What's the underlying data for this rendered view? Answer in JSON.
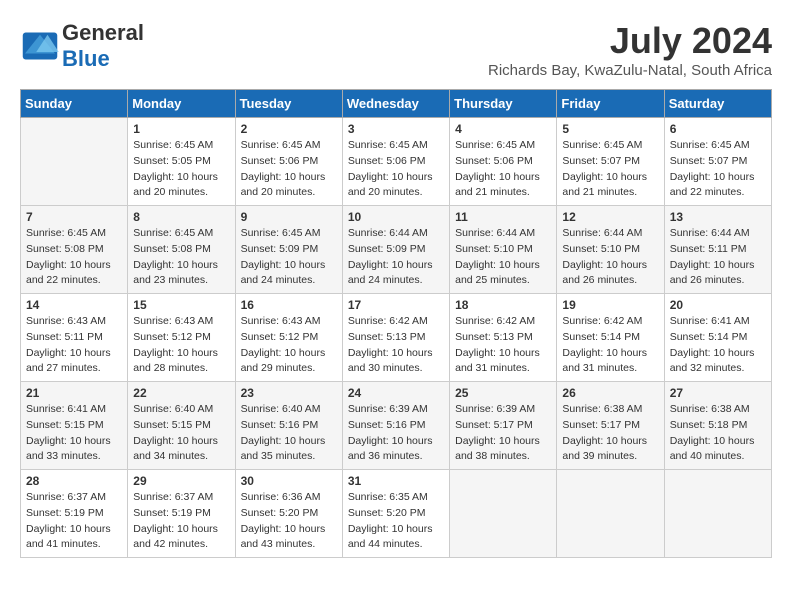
{
  "logo": {
    "general": "General",
    "blue": "Blue"
  },
  "title": {
    "month_year": "July 2024",
    "location": "Richards Bay, KwaZulu-Natal, South Africa"
  },
  "days_of_week": [
    "Sunday",
    "Monday",
    "Tuesday",
    "Wednesday",
    "Thursday",
    "Friday",
    "Saturday"
  ],
  "weeks": [
    [
      {
        "day": "",
        "sunrise": "",
        "sunset": "",
        "daylight": ""
      },
      {
        "day": "1",
        "sunrise": "Sunrise: 6:45 AM",
        "sunset": "Sunset: 5:05 PM",
        "daylight": "Daylight: 10 hours and 20 minutes."
      },
      {
        "day": "2",
        "sunrise": "Sunrise: 6:45 AM",
        "sunset": "Sunset: 5:06 PM",
        "daylight": "Daylight: 10 hours and 20 minutes."
      },
      {
        "day": "3",
        "sunrise": "Sunrise: 6:45 AM",
        "sunset": "Sunset: 5:06 PM",
        "daylight": "Daylight: 10 hours and 20 minutes."
      },
      {
        "day": "4",
        "sunrise": "Sunrise: 6:45 AM",
        "sunset": "Sunset: 5:06 PM",
        "daylight": "Daylight: 10 hours and 21 minutes."
      },
      {
        "day": "5",
        "sunrise": "Sunrise: 6:45 AM",
        "sunset": "Sunset: 5:07 PM",
        "daylight": "Daylight: 10 hours and 21 minutes."
      },
      {
        "day": "6",
        "sunrise": "Sunrise: 6:45 AM",
        "sunset": "Sunset: 5:07 PM",
        "daylight": "Daylight: 10 hours and 22 minutes."
      }
    ],
    [
      {
        "day": "7",
        "sunrise": "Sunrise: 6:45 AM",
        "sunset": "Sunset: 5:08 PM",
        "daylight": "Daylight: 10 hours and 22 minutes."
      },
      {
        "day": "8",
        "sunrise": "Sunrise: 6:45 AM",
        "sunset": "Sunset: 5:08 PM",
        "daylight": "Daylight: 10 hours and 23 minutes."
      },
      {
        "day": "9",
        "sunrise": "Sunrise: 6:45 AM",
        "sunset": "Sunset: 5:09 PM",
        "daylight": "Daylight: 10 hours and 24 minutes."
      },
      {
        "day": "10",
        "sunrise": "Sunrise: 6:44 AM",
        "sunset": "Sunset: 5:09 PM",
        "daylight": "Daylight: 10 hours and 24 minutes."
      },
      {
        "day": "11",
        "sunrise": "Sunrise: 6:44 AM",
        "sunset": "Sunset: 5:10 PM",
        "daylight": "Daylight: 10 hours and 25 minutes."
      },
      {
        "day": "12",
        "sunrise": "Sunrise: 6:44 AM",
        "sunset": "Sunset: 5:10 PM",
        "daylight": "Daylight: 10 hours and 26 minutes."
      },
      {
        "day": "13",
        "sunrise": "Sunrise: 6:44 AM",
        "sunset": "Sunset: 5:11 PM",
        "daylight": "Daylight: 10 hours and 26 minutes."
      }
    ],
    [
      {
        "day": "14",
        "sunrise": "Sunrise: 6:43 AM",
        "sunset": "Sunset: 5:11 PM",
        "daylight": "Daylight: 10 hours and 27 minutes."
      },
      {
        "day": "15",
        "sunrise": "Sunrise: 6:43 AM",
        "sunset": "Sunset: 5:12 PM",
        "daylight": "Daylight: 10 hours and 28 minutes."
      },
      {
        "day": "16",
        "sunrise": "Sunrise: 6:43 AM",
        "sunset": "Sunset: 5:12 PM",
        "daylight": "Daylight: 10 hours and 29 minutes."
      },
      {
        "day": "17",
        "sunrise": "Sunrise: 6:42 AM",
        "sunset": "Sunset: 5:13 PM",
        "daylight": "Daylight: 10 hours and 30 minutes."
      },
      {
        "day": "18",
        "sunrise": "Sunrise: 6:42 AM",
        "sunset": "Sunset: 5:13 PM",
        "daylight": "Daylight: 10 hours and 31 minutes."
      },
      {
        "day": "19",
        "sunrise": "Sunrise: 6:42 AM",
        "sunset": "Sunset: 5:14 PM",
        "daylight": "Daylight: 10 hours and 31 minutes."
      },
      {
        "day": "20",
        "sunrise": "Sunrise: 6:41 AM",
        "sunset": "Sunset: 5:14 PM",
        "daylight": "Daylight: 10 hours and 32 minutes."
      }
    ],
    [
      {
        "day": "21",
        "sunrise": "Sunrise: 6:41 AM",
        "sunset": "Sunset: 5:15 PM",
        "daylight": "Daylight: 10 hours and 33 minutes."
      },
      {
        "day": "22",
        "sunrise": "Sunrise: 6:40 AM",
        "sunset": "Sunset: 5:15 PM",
        "daylight": "Daylight: 10 hours and 34 minutes."
      },
      {
        "day": "23",
        "sunrise": "Sunrise: 6:40 AM",
        "sunset": "Sunset: 5:16 PM",
        "daylight": "Daylight: 10 hours and 35 minutes."
      },
      {
        "day": "24",
        "sunrise": "Sunrise: 6:39 AM",
        "sunset": "Sunset: 5:16 PM",
        "daylight": "Daylight: 10 hours and 36 minutes."
      },
      {
        "day": "25",
        "sunrise": "Sunrise: 6:39 AM",
        "sunset": "Sunset: 5:17 PM",
        "daylight": "Daylight: 10 hours and 38 minutes."
      },
      {
        "day": "26",
        "sunrise": "Sunrise: 6:38 AM",
        "sunset": "Sunset: 5:17 PM",
        "daylight": "Daylight: 10 hours and 39 minutes."
      },
      {
        "day": "27",
        "sunrise": "Sunrise: 6:38 AM",
        "sunset": "Sunset: 5:18 PM",
        "daylight": "Daylight: 10 hours and 40 minutes."
      }
    ],
    [
      {
        "day": "28",
        "sunrise": "Sunrise: 6:37 AM",
        "sunset": "Sunset: 5:19 PM",
        "daylight": "Daylight: 10 hours and 41 minutes."
      },
      {
        "day": "29",
        "sunrise": "Sunrise: 6:37 AM",
        "sunset": "Sunset: 5:19 PM",
        "daylight": "Daylight: 10 hours and 42 minutes."
      },
      {
        "day": "30",
        "sunrise": "Sunrise: 6:36 AM",
        "sunset": "Sunset: 5:20 PM",
        "daylight": "Daylight: 10 hours and 43 minutes."
      },
      {
        "day": "31",
        "sunrise": "Sunrise: 6:35 AM",
        "sunset": "Sunset: 5:20 PM",
        "daylight": "Daylight: 10 hours and 44 minutes."
      },
      {
        "day": "",
        "sunrise": "",
        "sunset": "",
        "daylight": ""
      },
      {
        "day": "",
        "sunrise": "",
        "sunset": "",
        "daylight": ""
      },
      {
        "day": "",
        "sunrise": "",
        "sunset": "",
        "daylight": ""
      }
    ]
  ]
}
